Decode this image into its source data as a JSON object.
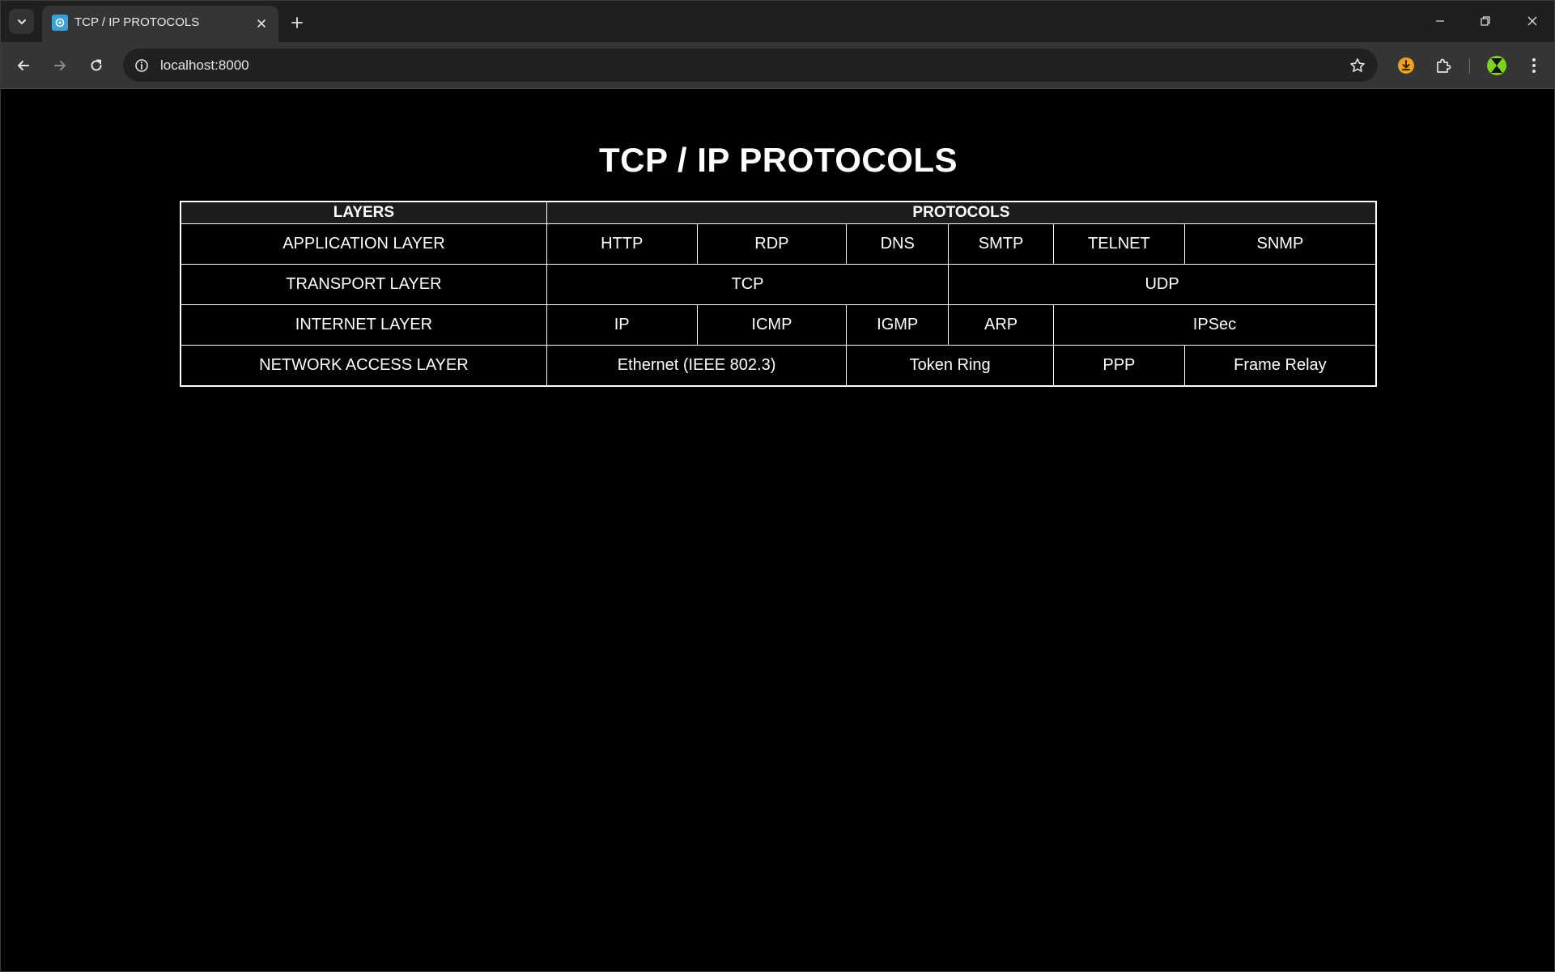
{
  "browser": {
    "tab_title": "TCP / IP PROTOCOLS",
    "url": "localhost:8000"
  },
  "page": {
    "title": "TCP / IP PROTOCOLS",
    "table": {
      "headers": {
        "layers": "LAYERS",
        "protocols": "PROTOCOLS"
      },
      "rows": [
        {
          "layer": "APPLICATION LAYER",
          "cells": [
            "HTTP",
            "RDP",
            "DNS",
            "SMTP",
            "TELNET",
            "SNMP"
          ]
        },
        {
          "layer": "TRANSPORT LAYER",
          "cells": [
            "TCP",
            "UDP"
          ]
        },
        {
          "layer": "INTERNET LAYER",
          "cells": [
            "IP",
            "ICMP",
            "IGMP",
            "ARP",
            "IPSec"
          ]
        },
        {
          "layer": "NETWORK ACCESS LAYER",
          "cells": [
            "Ethernet (IEEE 802.3)",
            "Token Ring",
            "PPP",
            "Frame Relay"
          ]
        }
      ]
    }
  },
  "colors": {
    "page_background": "#000000",
    "text": "#ffffff",
    "table_border": "#ffffff",
    "tab_strip": "#1f1f1f",
    "toolbar": "#353535",
    "download_badge": "#f0a020",
    "profile_badge": "#7ed321"
  },
  "icons": {
    "tab_search": "chevron-down-icon",
    "favicon": "site-favicon-icon",
    "tab_close": "close-icon",
    "new_tab": "plus-icon",
    "minimize": "minimize-icon",
    "restore": "restore-icon",
    "close_window": "close-icon",
    "back": "arrow-left-icon",
    "forward": "arrow-right-icon",
    "reload": "reload-icon",
    "site_info": "info-icon",
    "bookmark": "star-icon",
    "download": "download-icon",
    "extensions": "puzzle-icon",
    "profile": "profile-icon",
    "menu": "kebab-menu-icon"
  }
}
